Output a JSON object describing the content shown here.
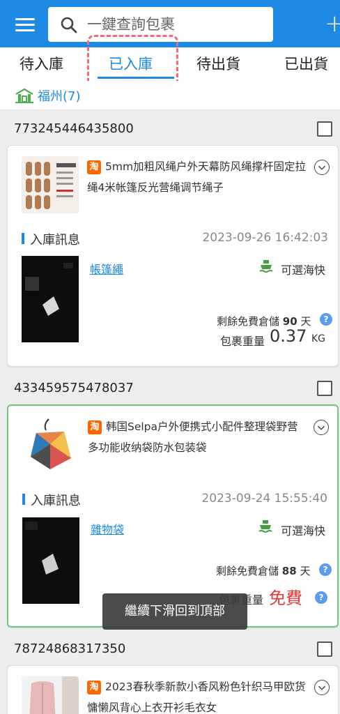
{
  "header": {
    "search_placeholder": "一鍵查詢包裹",
    "plus_label": "+"
  },
  "tabs": [
    {
      "label": "待入庫",
      "active": false
    },
    {
      "label": "已入庫",
      "active": true
    },
    {
      "label": "待出貨",
      "active": false
    },
    {
      "label": "已出貨",
      "active": false
    }
  ],
  "location": {
    "label": "福州(7)"
  },
  "packages": [
    {
      "tracking_number": "773245446435800",
      "product_badge": "淘",
      "product_title": "5mm加粗风绳户外天幕防风绳撑杆固定拉绳4米帐篷反光营绳调节绳子",
      "section_title": "入庫訊息",
      "timestamp": "2023-09-26 16:42:03",
      "item_name": "帳篷繩",
      "shipping": "可選海快",
      "storage_label": "剩餘免費倉儲",
      "storage_days": "90",
      "storage_unit": "天",
      "weight_label": "包裹重量",
      "weight_value": "0.37",
      "weight_unit": "KG"
    },
    {
      "tracking_number": "433459575478037",
      "product_badge": "淘",
      "product_title": "韩国Selpa户外便携式小配件整理袋野营多功能收纳袋防水包装袋",
      "section_title": "入庫訊息",
      "timestamp": "2023-09-24 15:55:40",
      "item_name": "雜物袋",
      "shipping": "可選海快",
      "storage_label": "剩餘免費倉儲",
      "storage_days": "88",
      "storage_unit": "天",
      "weight_label": "包裹重量",
      "weight_value": "免費"
    },
    {
      "tracking_number": "78724868317350",
      "product_badge": "淘",
      "product_title": "2023春秋季新款小香风粉色针织马甲欧货慵懒风背心上衣开衫毛衣女"
    }
  ],
  "toast": {
    "text": "繼續下滑回到頂部"
  },
  "colors": {
    "primary": "#1e88e5",
    "free": "#e53935",
    "selected_border": "#6cc77b",
    "highlight": "#f06b78",
    "taobao": "#ff6600"
  }
}
